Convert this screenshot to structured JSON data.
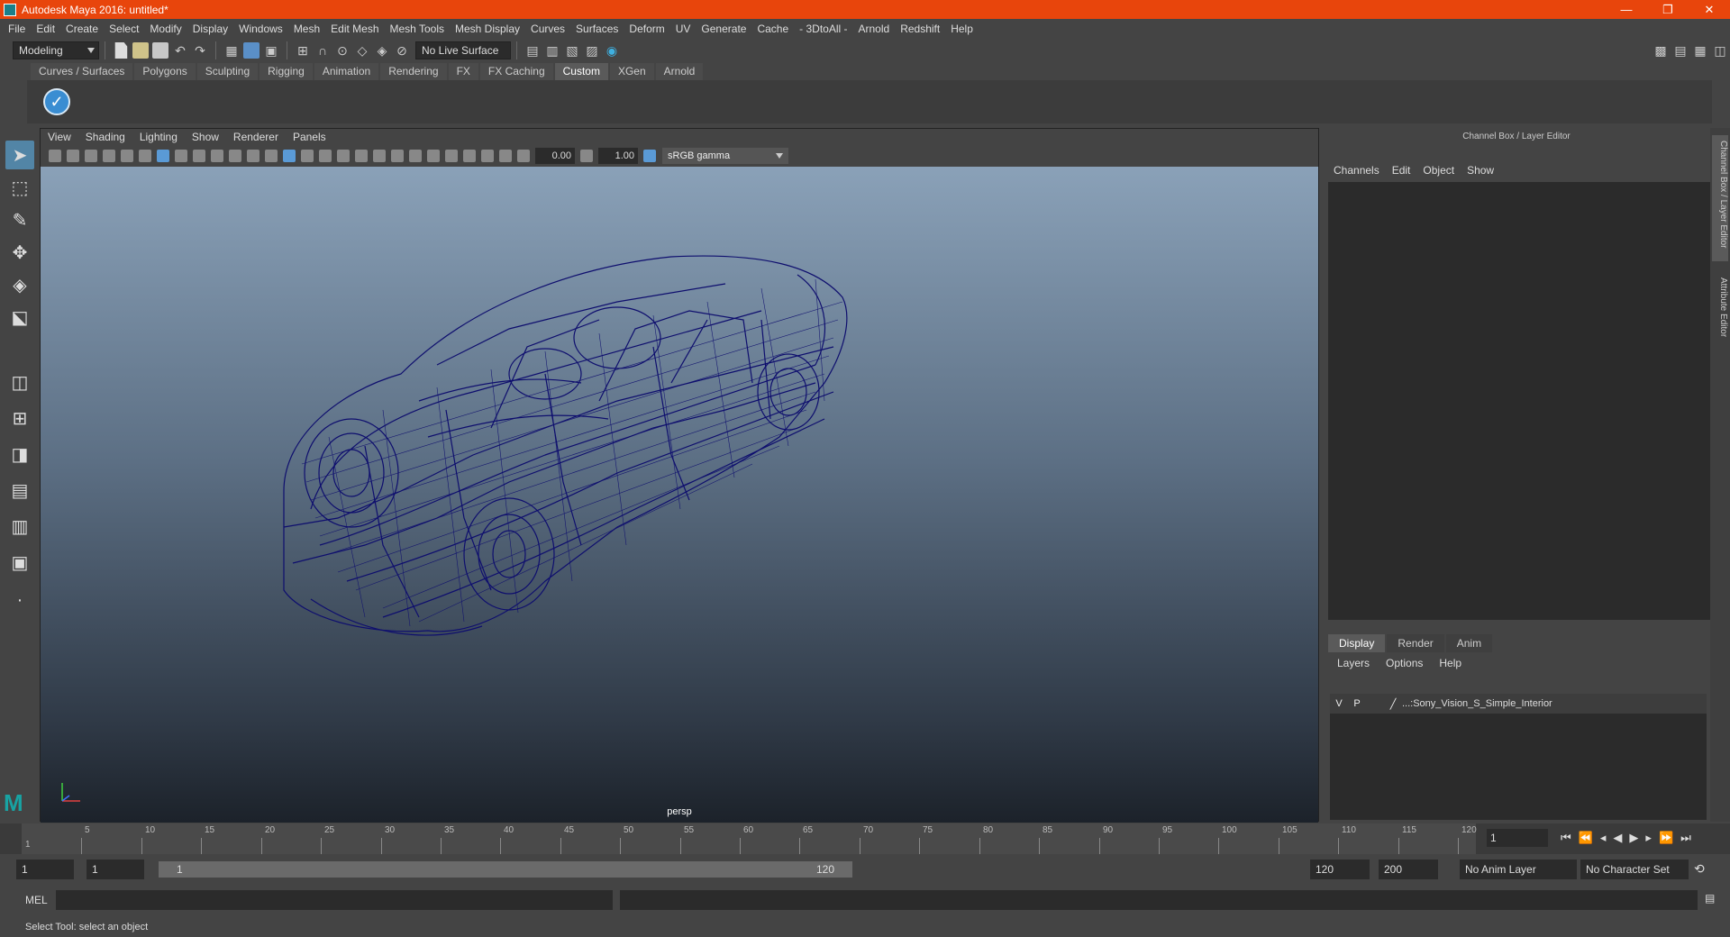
{
  "window": {
    "title": "Autodesk Maya 2016: untitled*",
    "min": "—",
    "max": "❐",
    "close": "✕"
  },
  "menubar": [
    "File",
    "Edit",
    "Create",
    "Select",
    "Modify",
    "Display",
    "Windows",
    "Mesh",
    "Edit Mesh",
    "Mesh Tools",
    "Mesh Display",
    "Curves",
    "Surfaces",
    "Deform",
    "UV",
    "Generate",
    "Cache",
    "- 3DtoAll -",
    "Arnold",
    "Redshift",
    "Help"
  ],
  "statusline": {
    "mode": "Modeling",
    "live_surface": "No Live Surface"
  },
  "shelf": {
    "tabs": [
      "Curves / Surfaces",
      "Polygons",
      "Sculpting",
      "Rigging",
      "Animation",
      "Rendering",
      "FX",
      "FX Caching",
      "Custom",
      "XGen",
      "Arnold"
    ],
    "active": "Custom"
  },
  "viewport": {
    "menu": [
      "View",
      "Shading",
      "Lighting",
      "Show",
      "Renderer",
      "Panels"
    ],
    "exposure": "0.00",
    "gamma_value": "1.00",
    "color_space": "sRGB gamma",
    "camera": "persp",
    "wire_color": "#0e0e6e",
    "bg_top": "#8aa1b8",
    "bg_bottom": "#1c222a"
  },
  "channel_box": {
    "title": "Channel Box / Layer Editor",
    "menu": [
      "Channels",
      "Edit",
      "Object",
      "Show"
    ]
  },
  "layer_editor": {
    "tabs": [
      "Display",
      "Render",
      "Anim"
    ],
    "active": "Display",
    "menu": [
      "Layers",
      "Options",
      "Help"
    ],
    "layer": {
      "v": "V",
      "p": "P",
      "name": "...:Sony_Vision_S_Simple_Interior"
    }
  },
  "side_tabs": [
    "Channel Box / Layer Editor",
    "Attribute Editor"
  ],
  "timeline": {
    "ticks": [
      "5",
      "10",
      "15",
      "20",
      "25",
      "30",
      "35",
      "40",
      "45",
      "50",
      "55",
      "60",
      "65",
      "70",
      "75",
      "80",
      "85",
      "90",
      "95",
      "100",
      "105",
      "110",
      "115",
      "120"
    ],
    "start_label": "1",
    "current_frame": "1"
  },
  "range": {
    "start": "1",
    "inner_start": "1",
    "slider_start": "1",
    "slider_end": "120",
    "end": "120",
    "max": "200",
    "anim_layer": "No Anim Layer",
    "char_set": "No Character Set"
  },
  "mel": {
    "label": "MEL"
  },
  "help_line": "Select Tool: select an object"
}
